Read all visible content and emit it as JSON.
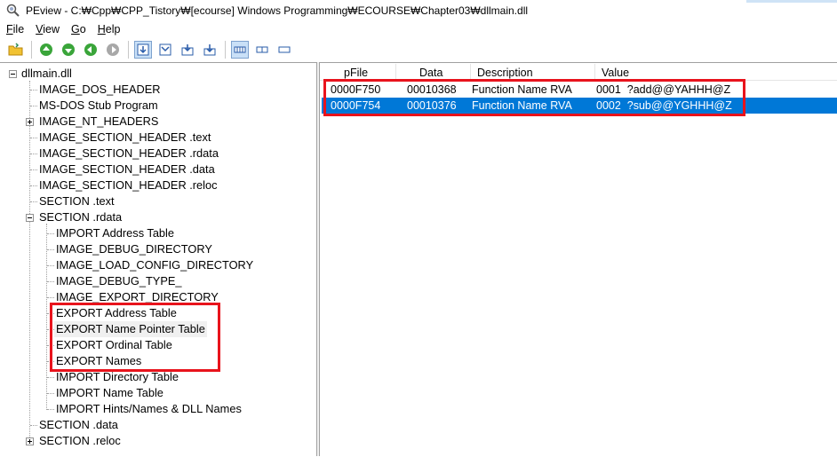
{
  "window": {
    "title": "PEview - C:₩Cpp₩CPP_Tistory₩[ecourse] Windows Programming₩ECOURSE₩Chapter03₩dllmain.dll"
  },
  "menu": [
    "File",
    "View",
    "Go",
    "Help"
  ],
  "toolbar_icons": [
    "open-folder-icon",
    "go-back-icon",
    "go-forward-icon",
    "go-up-icon",
    "go-disabled-icon",
    "view-byte-icon",
    "view-word-icon",
    "view-dword-icon",
    "view-qword-icon",
    "view-hex-icon",
    "view-text-icon",
    "view-default-icon"
  ],
  "tree": {
    "root": "dllmain.dll",
    "items": [
      {
        "label": "IMAGE_DOS_HEADER"
      },
      {
        "label": "MS-DOS Stub Program"
      },
      {
        "label": "IMAGE_NT_HEADERS"
      },
      {
        "label": "IMAGE_SECTION_HEADER .text"
      },
      {
        "label": "IMAGE_SECTION_HEADER .rdata"
      },
      {
        "label": "IMAGE_SECTION_HEADER .data"
      },
      {
        "label": "IMAGE_SECTION_HEADER .reloc"
      },
      {
        "label": "SECTION .text"
      },
      {
        "label": "SECTION .rdata"
      },
      {
        "label": "SECTION .data"
      },
      {
        "label": "SECTION .reloc"
      }
    ],
    "rdata_children": [
      {
        "label": "IMPORT Address Table"
      },
      {
        "label": "IMAGE_DEBUG_DIRECTORY"
      },
      {
        "label": "IMAGE_LOAD_CONFIG_DIRECTORY"
      },
      {
        "label": "IMAGE_DEBUG_TYPE_"
      },
      {
        "label": "IMAGE_EXPORT_DIRECTORY"
      },
      {
        "label": "EXPORT Address Table"
      },
      {
        "label": "EXPORT Name Pointer Table"
      },
      {
        "label": "EXPORT Ordinal Table"
      },
      {
        "label": "EXPORT Names"
      },
      {
        "label": "IMPORT Directory Table"
      },
      {
        "label": "IMPORT Name Table"
      },
      {
        "label": "IMPORT Hints/Names & DLL Names"
      }
    ]
  },
  "list": {
    "columns": [
      "pFile",
      "Data",
      "Description",
      "Value"
    ],
    "rows": [
      {
        "pfile": "0000F750",
        "data": "00010368",
        "description": "Function Name RVA",
        "value": "0001  ?add@@YAHHH@Z"
      },
      {
        "pfile": "0000F754",
        "data": "00010376",
        "description": "Function Name RVA",
        "value": "0002  ?sub@@YGHHH@Z"
      }
    ],
    "selected_index": 1
  },
  "colors": {
    "selection": "#0078d7",
    "highlight_box": "#e8131c"
  }
}
